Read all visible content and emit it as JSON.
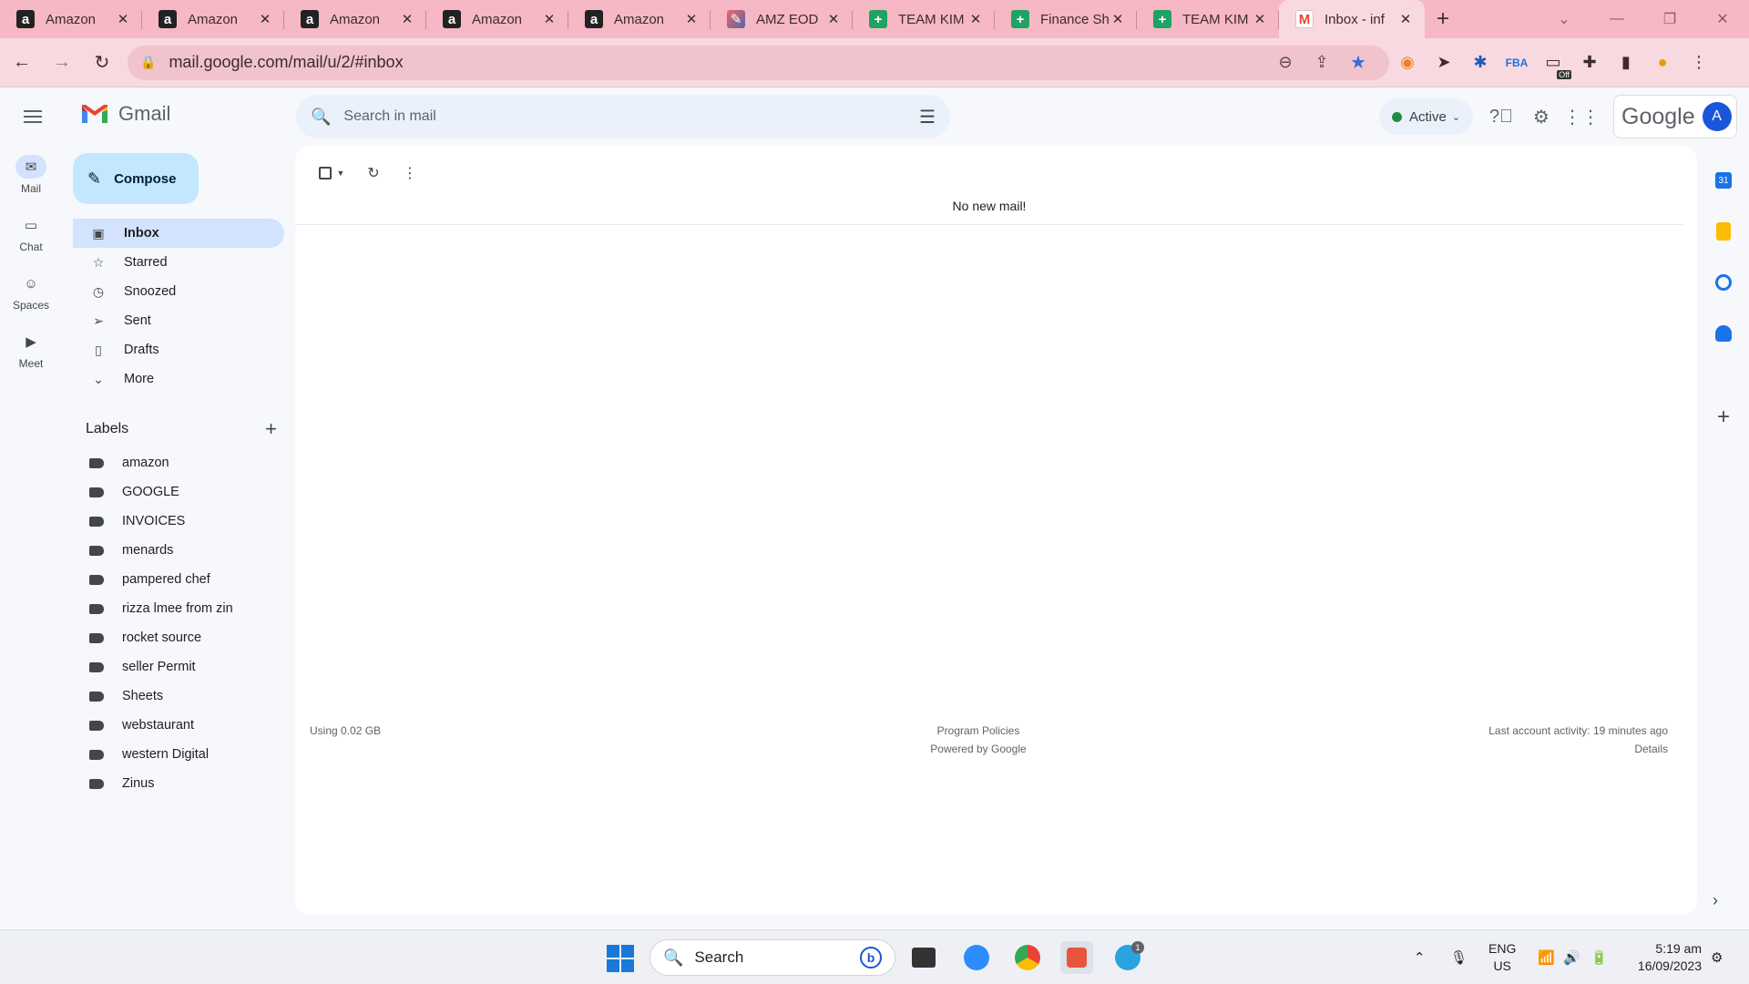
{
  "browser": {
    "tabs": [
      {
        "title": "Amazon",
        "icon": "amazon-icon"
      },
      {
        "title": "Amazon",
        "icon": "amazon-icon"
      },
      {
        "title": "Amazon",
        "icon": "amazon-icon"
      },
      {
        "title": "Amazon",
        "icon": "amazon-icon"
      },
      {
        "title": "Amazon",
        "icon": "amazon-icon"
      },
      {
        "title": "AMZ EOD",
        "icon": "amz-eod-icon"
      },
      {
        "title": "TEAM KIM",
        "icon": "sheets-icon"
      },
      {
        "title": "Finance Sh",
        "icon": "sheets-icon"
      },
      {
        "title": "TEAM KIM",
        "icon": "sheets-icon"
      },
      {
        "title": "Inbox - inf",
        "icon": "gmail-icon",
        "active": true
      }
    ],
    "url": "mail.google.com/mail/u/2/#inbox",
    "extension_badge": "Off"
  },
  "header": {
    "app_name": "Gmail",
    "search_placeholder": "Search in mail",
    "status": "Active",
    "account_brand": "Google",
    "avatar_letter": "A"
  },
  "rail": [
    {
      "label": "Mail",
      "icon": "mail-icon",
      "active": true
    },
    {
      "label": "Chat",
      "icon": "chat-icon"
    },
    {
      "label": "Spaces",
      "icon": "spaces-icon"
    },
    {
      "label": "Meet",
      "icon": "meet-icon"
    }
  ],
  "compose_label": "Compose",
  "nav": [
    {
      "label": "Inbox",
      "icon": "inbox-icon",
      "active": true
    },
    {
      "label": "Starred",
      "icon": "star-icon"
    },
    {
      "label": "Snoozed",
      "icon": "clock-icon"
    },
    {
      "label": "Sent",
      "icon": "send-icon"
    },
    {
      "label": "Drafts",
      "icon": "draft-icon"
    },
    {
      "label": "More",
      "icon": "chevron-down-icon"
    }
  ],
  "labels_title": "Labels",
  "labels": [
    "amazon",
    "GOOGLE",
    "INVOICES",
    "menards",
    "pampered chef",
    "rizza lmee from zin",
    "rocket source",
    "seller Permit",
    "Sheets",
    "webstaurant",
    "western Digital",
    "Zinus"
  ],
  "main": {
    "empty_message": "No new mail!",
    "storage": "Using 0.02 GB",
    "policies": "Program Policies",
    "powered": "Powered by Google",
    "last_activity": "Last account activity: 19 minutes ago",
    "details": "Details"
  },
  "side_panel": {
    "calendar_day": "31"
  },
  "taskbar": {
    "search_label": "Search",
    "telegram_badge": "1",
    "lang": "ENG",
    "region": "US",
    "time": "5:19 am",
    "date": "16/09/2023"
  },
  "colors": {
    "tab_strip": "#f6b8c4",
    "toolbar": "#f8d9df",
    "compose": "#c2e7ff",
    "nav_active": "#d3e3fd",
    "status_green": "#1e8e3e",
    "avatar": "#1a56db"
  }
}
